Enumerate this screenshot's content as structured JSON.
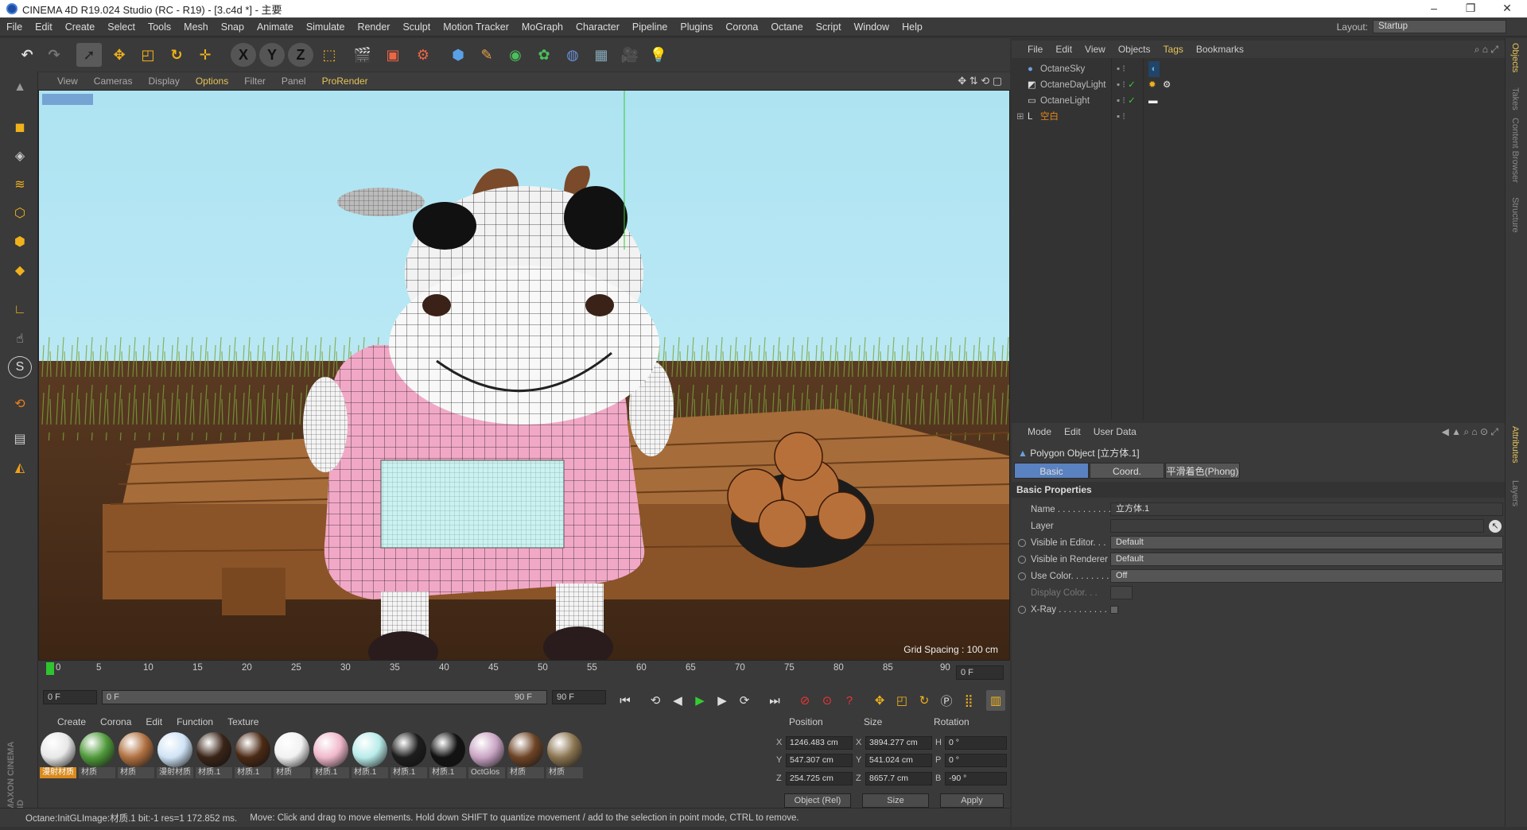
{
  "window": {
    "title": "CINEMA 4D R19.024 Studio (RC - R19) - [3.c4d *] - 主要"
  },
  "menu": [
    "File",
    "Edit",
    "Create",
    "Select",
    "Tools",
    "Mesh",
    "Snap",
    "Animate",
    "Simulate",
    "Render",
    "Sculpt",
    "Motion Tracker",
    "MoGraph",
    "Character",
    "Pipeline",
    "Plugins",
    "Corona",
    "Octane",
    "Script",
    "Window",
    "Help"
  ],
  "layout": {
    "label": "Layout:",
    "value": "Startup"
  },
  "viewport": {
    "menu": [
      "View",
      "Cameras",
      "Display",
      "Options",
      "Filter",
      "Panel",
      "ProRender"
    ],
    "grid_spacing": "Grid Spacing : 100 cm"
  },
  "timeline": {
    "ticks": [
      "0",
      "5",
      "10",
      "15",
      "20",
      "25",
      "30",
      "35",
      "40",
      "45",
      "50",
      "55",
      "60",
      "65",
      "70",
      "75",
      "80",
      "85",
      "90"
    ],
    "current_frame": "0 F",
    "start_frame": "0 F",
    "slider_start": "0 F",
    "slider_end": "90 F",
    "end_frame": "90 F"
  },
  "materials": {
    "menu": [
      "Create",
      "Corona",
      "Edit",
      "Function",
      "Texture"
    ],
    "items": [
      {
        "label": "漫射材质",
        "color": "#e8e8e8"
      },
      {
        "label": "材质",
        "color": "#4f9a3a"
      },
      {
        "label": "材质",
        "color": "#b07040"
      },
      {
        "label": "漫射材质",
        "color": "#cfe3f5"
      },
      {
        "label": "材质.1",
        "color": "#3a2418"
      },
      {
        "label": "材质.1",
        "color": "#4b2a15"
      },
      {
        "label": "材质",
        "color": "#f2f2f2"
      },
      {
        "label": "材质.1",
        "color": "#f0b8cc"
      },
      {
        "label": "材质.1",
        "color": "#b8ecea"
      },
      {
        "label": "材质.1",
        "color": "#1d1d1d"
      },
      {
        "label": "材质.1",
        "color": "#121212"
      },
      {
        "label": "OctGlos",
        "color": "#c9a4c4"
      },
      {
        "label": "材质",
        "color": "#6e4426"
      },
      {
        "label": "材质",
        "color": "#8a7450"
      }
    ]
  },
  "coordinates": {
    "headers": [
      "Position",
      "Size",
      "Rotation"
    ],
    "rows": [
      {
        "axis": "X",
        "pos": "1246.483 cm",
        "saxis": "X",
        "size": "3894.277 cm",
        "raxis": "H",
        "rot": "0 °"
      },
      {
        "axis": "Y",
        "pos": "547.307 cm",
        "saxis": "Y",
        "size": "541.024 cm",
        "raxis": "P",
        "rot": "0 °"
      },
      {
        "axis": "Z",
        "pos": "254.725 cm",
        "saxis": "Z",
        "size": "8657.7 cm",
        "raxis": "B",
        "rot": "-90 °"
      }
    ],
    "mode": "Object (Rel)",
    "size_mode": "Size",
    "apply": "Apply"
  },
  "status": {
    "left": "Octane:InitGLImage:材质.1  bit:-1 res=1  172.852 ms.",
    "hint": "Move: Click and drag to move elements. Hold down SHIFT to quantize movement / add to the selection in point mode, CTRL to remove."
  },
  "object_manager": {
    "menu": [
      "File",
      "Edit",
      "View",
      "Objects",
      "Tags",
      "Bookmarks"
    ],
    "objects": [
      {
        "name": "OctaneSky"
      },
      {
        "name": "OctaneDayLight"
      },
      {
        "name": "OctaneLight"
      },
      {
        "name": "空白"
      }
    ]
  },
  "attributes": {
    "menu": [
      "Mode",
      "Edit",
      "User Data"
    ],
    "object_title": "Polygon Object [立方体.1]",
    "tabs": [
      "Basic",
      "Coord.",
      "平滑着色(Phong)"
    ],
    "section": "Basic Properties",
    "props": [
      {
        "label": "Name . . . . . . . . . . .",
        "value": "立方体.1"
      },
      {
        "label": "Layer",
        "value": ""
      },
      {
        "label": "Visible in Editor. . .",
        "value": "Default"
      },
      {
        "label": "Visible in Renderer",
        "value": "Default"
      },
      {
        "label": "Use Color. . . . . . . .",
        "value": "Off"
      },
      {
        "label": "Display Color. . .",
        "value": ""
      },
      {
        "label": "X-Ray . . . . . . . . . .",
        "value": ""
      }
    ]
  },
  "side_tabs": [
    "Objects",
    "Takes",
    "Content Browser",
    "Structure",
    "Attributes",
    "Layers"
  ]
}
